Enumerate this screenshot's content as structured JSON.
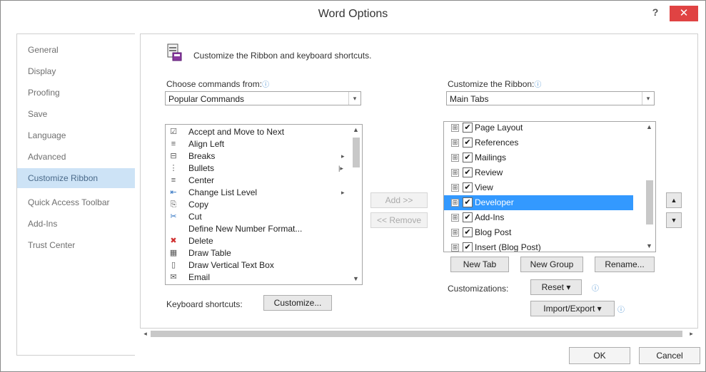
{
  "window": {
    "title": "Word Options",
    "help_label": "?",
    "close_label": "✕"
  },
  "sidebar": {
    "items": [
      {
        "label": "General"
      },
      {
        "label": "Display"
      },
      {
        "label": "Proofing"
      },
      {
        "label": "Save"
      },
      {
        "label": "Language"
      },
      {
        "label": "Advanced"
      },
      {
        "label": "Customize Ribbon",
        "active": true
      },
      {
        "label": "Quick Access Toolbar"
      },
      {
        "label": "Add-Ins"
      },
      {
        "label": "Trust Center"
      }
    ]
  },
  "header": {
    "text": "Customize the Ribbon and keyboard shortcuts."
  },
  "commands": {
    "label": "Choose commands from:",
    "info": "ⓘ",
    "value": "Popular Commands",
    "items": [
      {
        "label": "Accept and Move to Next",
        "icon": "☑"
      },
      {
        "label": "Align Left",
        "icon": "≡"
      },
      {
        "label": "Breaks",
        "icon": "⊟",
        "sub": "▸"
      },
      {
        "label": "Bullets",
        "icon": "⋮",
        "sub": "|▸"
      },
      {
        "label": "Center",
        "icon": "≡"
      },
      {
        "label": "Change List Level",
        "icon": "⇤",
        "sub": "▸"
      },
      {
        "label": "Copy",
        "icon": "⎘"
      },
      {
        "label": "Cut",
        "icon": "✂"
      },
      {
        "label": "Define New Number Format...",
        "icon": ""
      },
      {
        "label": "Delete",
        "icon": "✖"
      },
      {
        "label": "Draw Table",
        "icon": "▦"
      },
      {
        "label": "Draw Vertical Text Box",
        "icon": "▯"
      },
      {
        "label": "Email",
        "icon": "✉"
      }
    ]
  },
  "ribbon": {
    "label": "Customize the Ribbon:",
    "info": "ⓘ",
    "value": "Main Tabs",
    "items": [
      {
        "label": "Page Layout",
        "checked": "✔"
      },
      {
        "label": "References",
        "checked": "✔"
      },
      {
        "label": "Mailings",
        "checked": "✔"
      },
      {
        "label": "Review",
        "checked": "✔"
      },
      {
        "label": "View",
        "checked": "✔"
      },
      {
        "label": "Developer",
        "checked": "✔",
        "selected": true
      },
      {
        "label": "Add-Ins",
        "checked": "✔"
      },
      {
        "label": "Blog Post",
        "checked": "✔"
      },
      {
        "label": "Insert (Blog Post)",
        "checked": "✔"
      }
    ]
  },
  "buttons": {
    "add": "Add >>",
    "remove": "<< Remove",
    "new_tab": "New Tab",
    "new_group": "New Group",
    "rename": "Rename...",
    "customizations_label": "Customizations:",
    "reset": "Reset ▾",
    "import_export": "Import/Export ▾",
    "keyboard_label": "Keyboard shortcuts:",
    "customize": "Customize...",
    "ok": "OK",
    "cancel": "Cancel"
  },
  "icons": {
    "plus": "⊞",
    "chevron_down": "▾",
    "scroll_up": "▲",
    "scroll_down": "▼",
    "scroll_left": "◂",
    "scroll_right": "▸",
    "move_up": "▲",
    "move_down": "▼"
  }
}
